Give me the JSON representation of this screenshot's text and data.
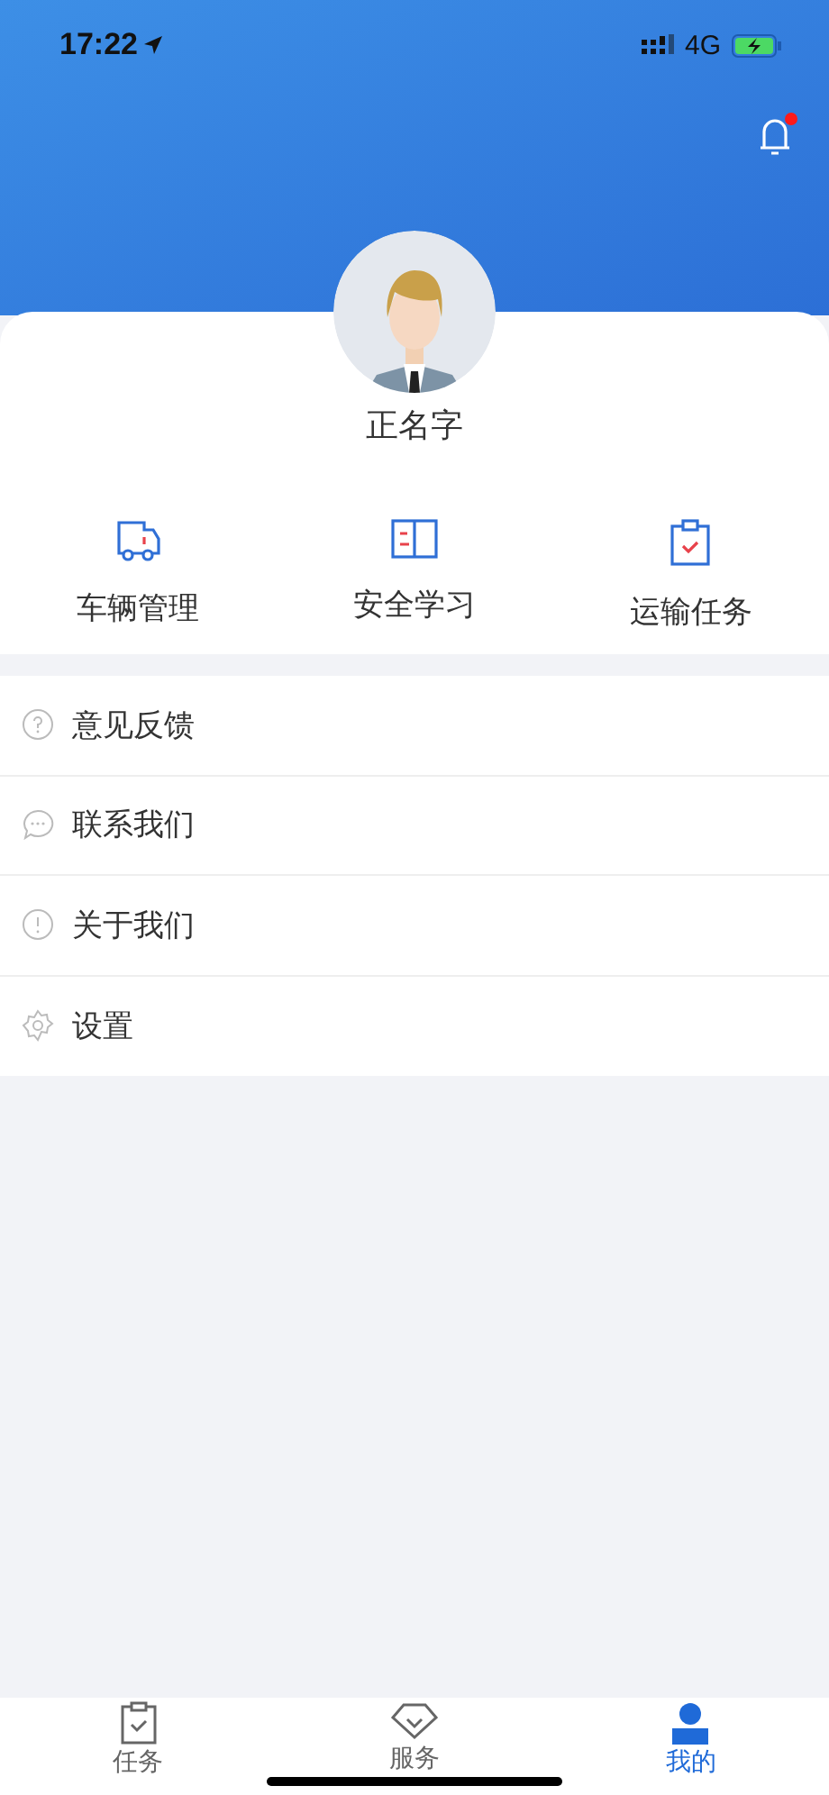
{
  "status_bar": {
    "time": "17:22",
    "network": "4G"
  },
  "header": {
    "notification": {
      "unread": true
    }
  },
  "profile": {
    "name": "正名字"
  },
  "shortcuts": [
    {
      "kind": "truck",
      "label": "车辆管理"
    },
    {
      "kind": "book",
      "label": "安全学习"
    },
    {
      "kind": "clipboard",
      "label": "运输任务"
    }
  ],
  "menu": [
    {
      "kind": "question",
      "label": "意见反馈"
    },
    {
      "kind": "chat",
      "label": "联系我们"
    },
    {
      "kind": "info",
      "label": "关于我们"
    },
    {
      "kind": "gear",
      "label": "设置"
    }
  ],
  "tab_bar": [
    {
      "kind": "clipboard",
      "label": "任务",
      "selected": false
    },
    {
      "kind": "diamond",
      "label": "服务",
      "selected": false
    },
    {
      "kind": "person",
      "label": "我的",
      "selected": true
    }
  ]
}
